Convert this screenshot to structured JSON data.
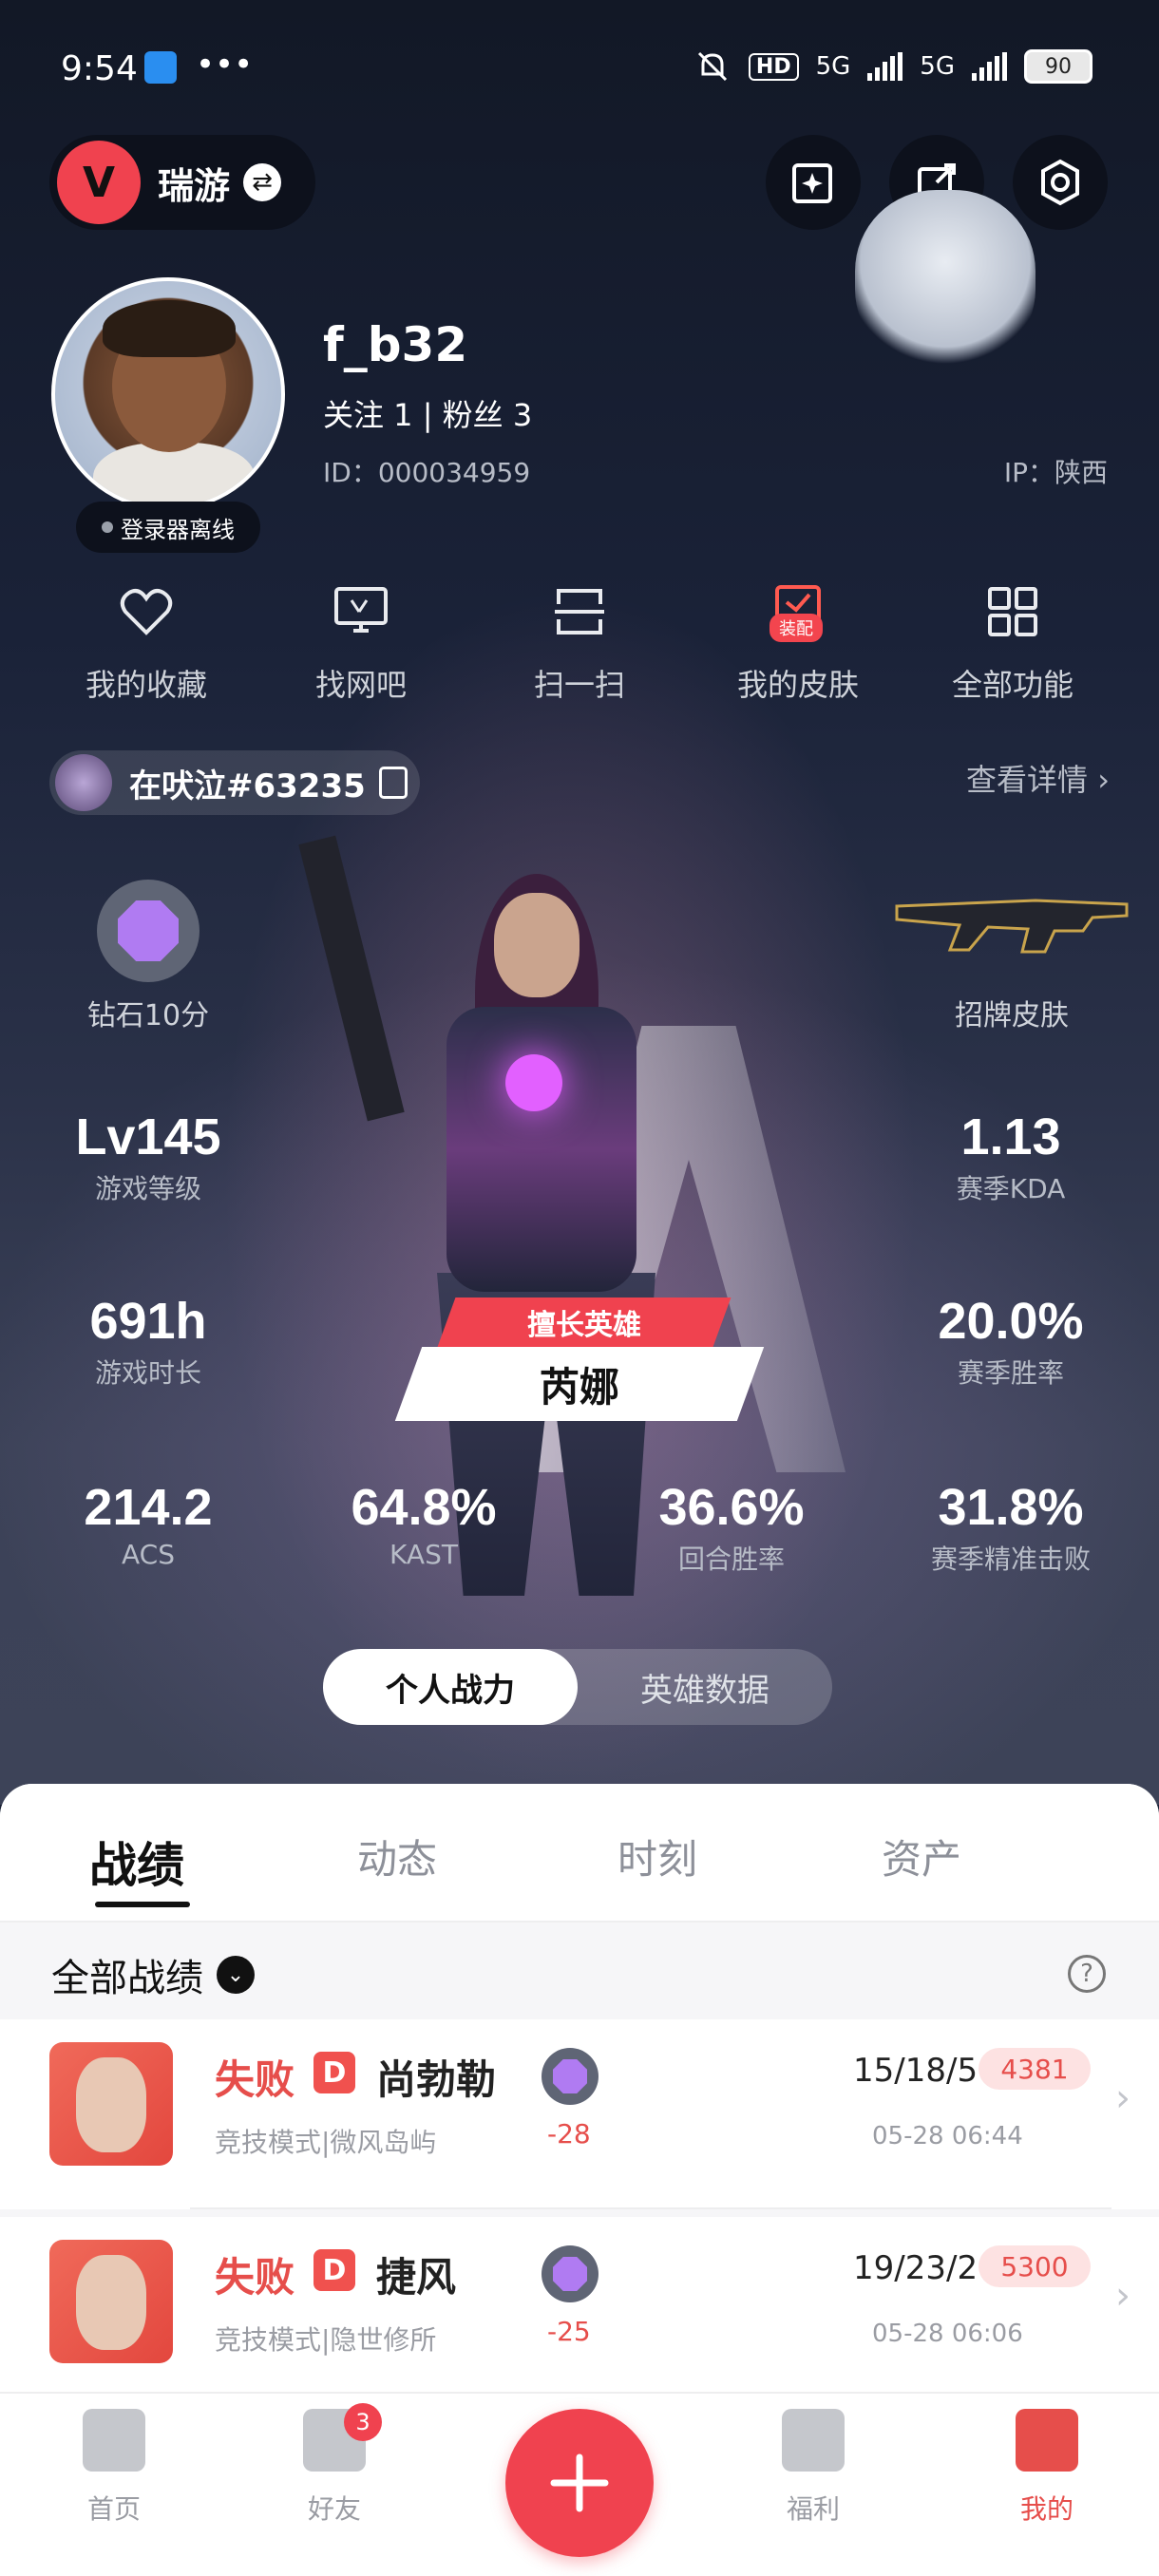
{
  "status_bar": {
    "time": "9:54",
    "dots": "•••",
    "hd": "HD",
    "net1": "5G",
    "net2": "5G",
    "battery": "90"
  },
  "app_bar": {
    "app_name": "瑞游",
    "logo_glyph": "V",
    "swap_glyph": "⇄"
  },
  "profile": {
    "username": "f_b32",
    "follow_text": "关注 1  |  粉丝 3",
    "id_text": "ID：000034959",
    "ip_text": "IP：陕西",
    "status_text": "登录器离线"
  },
  "quick_actions": [
    {
      "label": "我的收藏",
      "icon": "heart-icon"
    },
    {
      "label": "找网吧",
      "icon": "monitor-icon"
    },
    {
      "label": "扫一扫",
      "icon": "scan-icon"
    },
    {
      "label": "我的皮肤",
      "icon": "skin-icon",
      "badge": "装配"
    },
    {
      "label": "全部功能",
      "icon": "grid-icon"
    }
  ],
  "riot": {
    "name": "在吠泣#63235",
    "view_detail": "查看详情 ›"
  },
  "rank": {
    "label": "钻石10分"
  },
  "skin": {
    "label": "招牌皮肤"
  },
  "stats": {
    "level": {
      "value": "Lv145",
      "label": "游戏等级"
    },
    "kda": {
      "value": "1.13",
      "label": "赛季KDA"
    },
    "hours": {
      "value": "691h",
      "label": "游戏时长"
    },
    "winrate": {
      "value": "20.0%",
      "label": "赛季胜率"
    },
    "acs": {
      "value": "214.2",
      "label": "ACS"
    },
    "kast": {
      "value": "64.8%",
      "label": "KAST"
    },
    "round_win": {
      "value": "36.6%",
      "label": "回合胜率"
    },
    "precise_kill": {
      "value": "31.8%",
      "label": "赛季精准击败"
    }
  },
  "best_agent": {
    "tag": "擅长英雄",
    "name": "芮娜"
  },
  "toggle": {
    "personal": "个人战力",
    "agent_data": "英雄数据"
  },
  "tabs": [
    "战绩",
    "动态",
    "时刻",
    "资产"
  ],
  "filter": {
    "label": "全部战绩",
    "chev": "⌄",
    "help": "?"
  },
  "matches": [
    {
      "result": "失败",
      "tag": "D",
      "agent": "尚勃勒",
      "mode": "竞技模式|微风岛屿",
      "delta": "-28",
      "kda": "15/18/5",
      "score": "4381",
      "time": "05-28 06:44"
    },
    {
      "result": "失败",
      "tag": "D",
      "agent": "捷风",
      "mode": "竞技模式|隐世修所",
      "delta": "-25",
      "kda": "19/23/2",
      "score": "5300",
      "time": "05-28 06:06"
    }
  ],
  "bottom_nav": {
    "home": "首页",
    "friends": "好友",
    "friends_badge": "3",
    "welfare": "福利",
    "mine": "我的"
  },
  "colors": {
    "accent": "#f0424f",
    "loss": "#e64e4b",
    "rank_gem": "#b07bf2"
  }
}
